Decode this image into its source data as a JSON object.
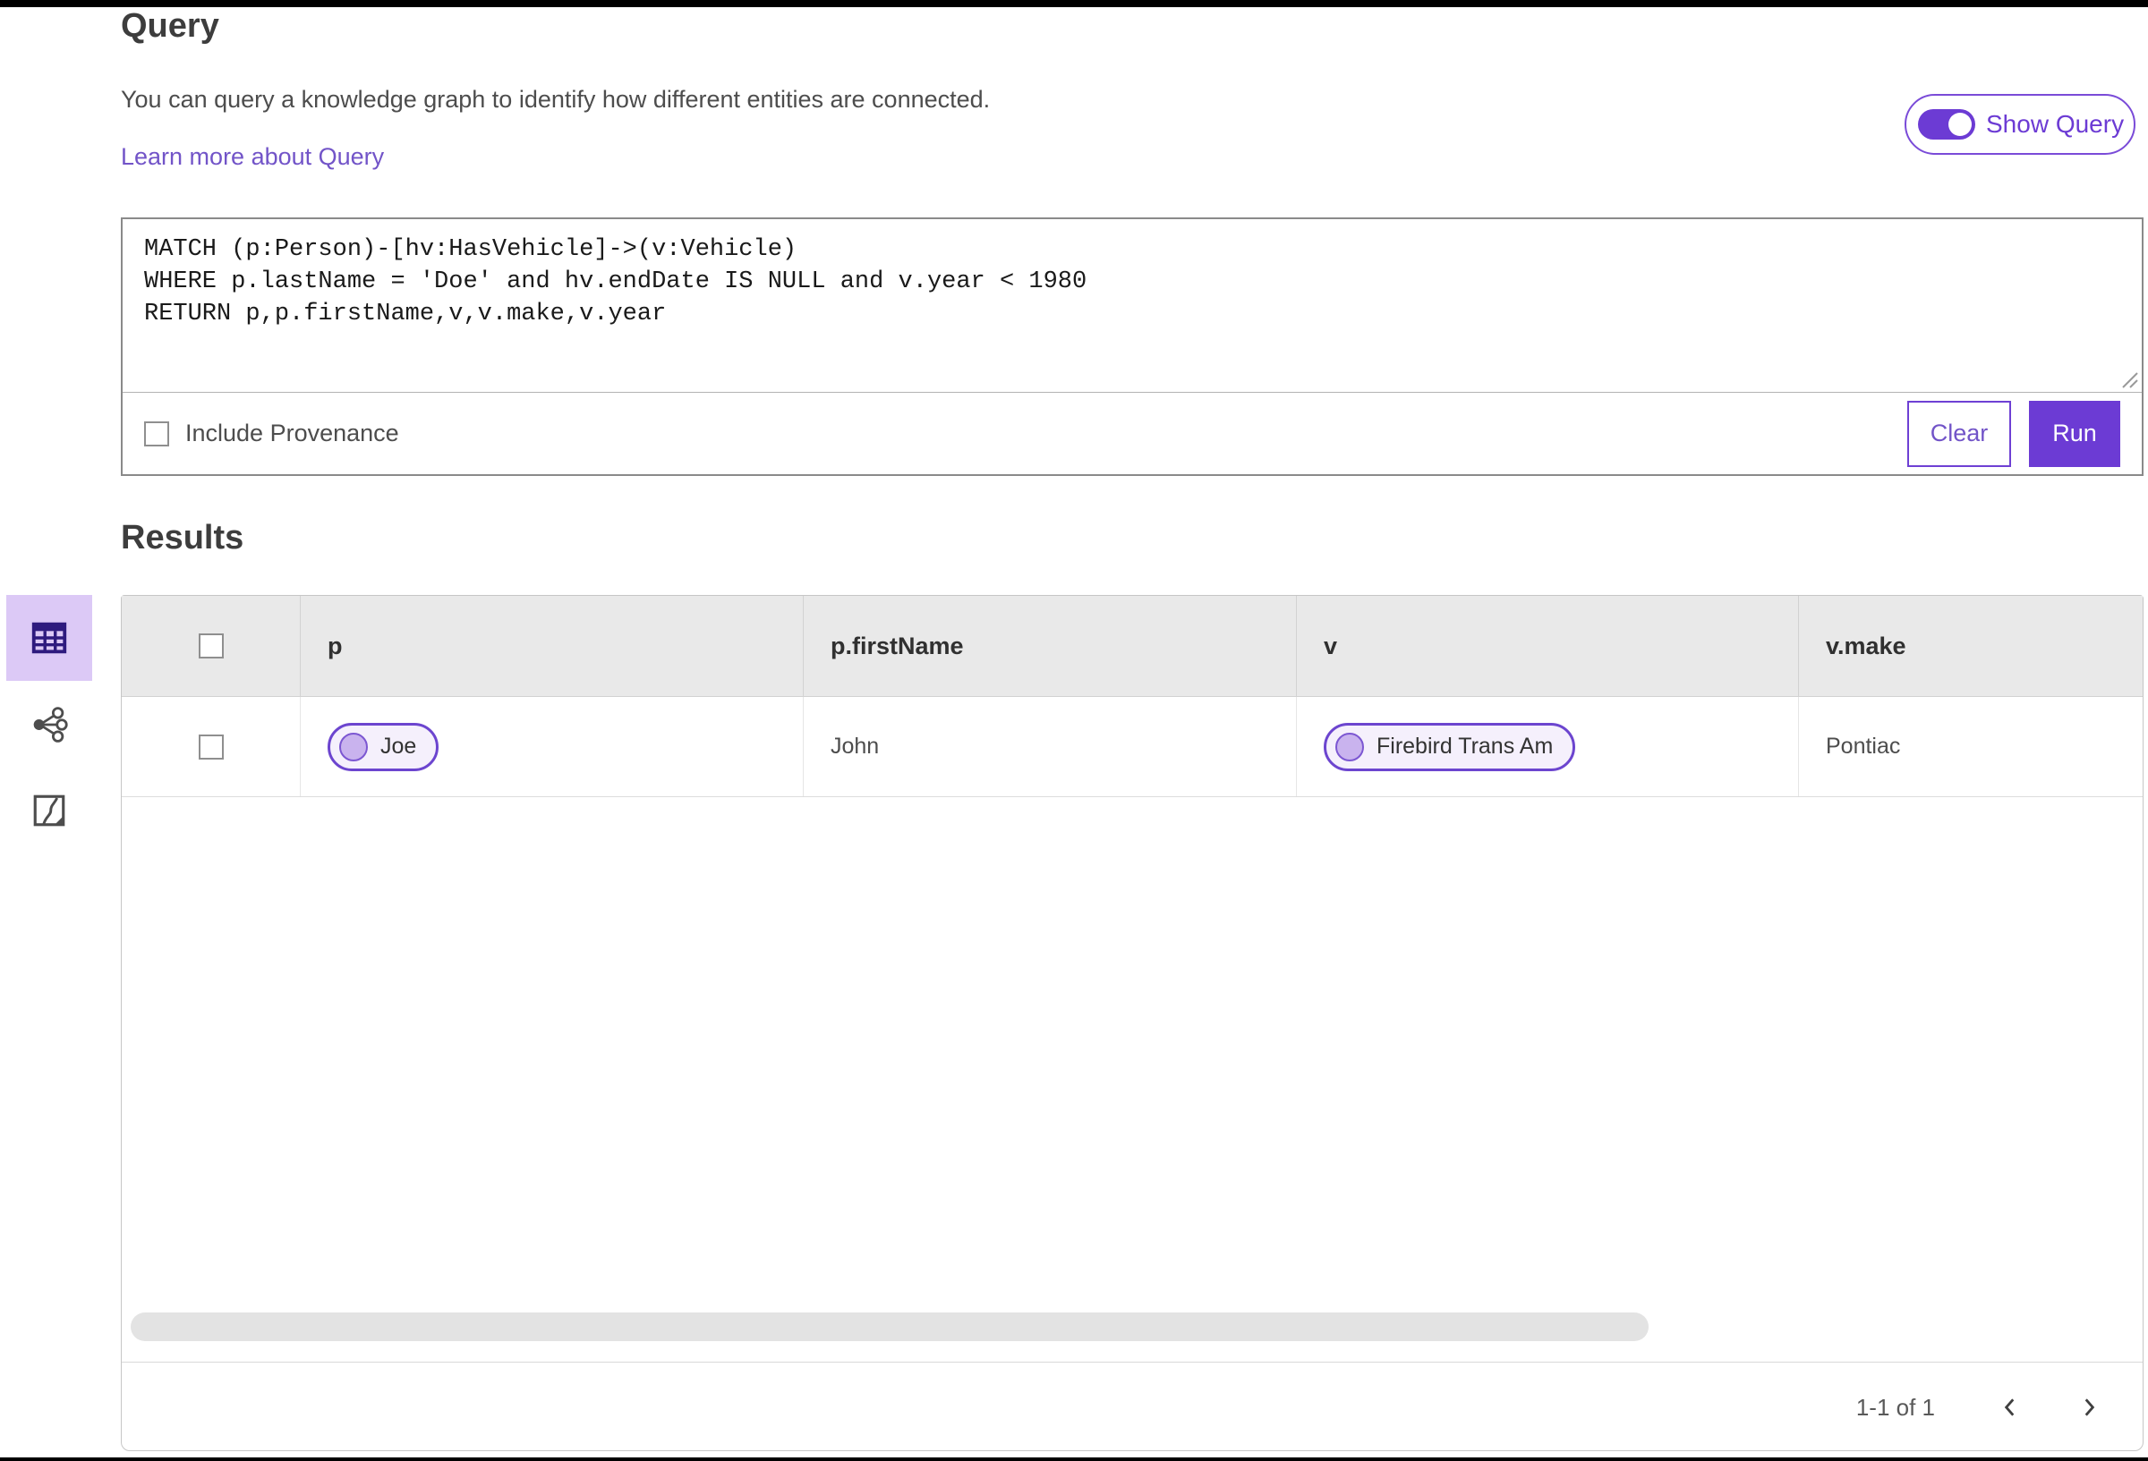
{
  "page": {
    "title": "Query",
    "description": "You can query a knowledge graph to identify how different entities are connected.",
    "learn_more_link": "Learn more about Query",
    "show_query_toggle": {
      "label": "Show Query",
      "state": "on"
    }
  },
  "query_editor": {
    "text": "MATCH (p:Person)-[hv:HasVehicle]->(v:Vehicle)\nWHERE p.lastName = 'Doe' and hv.endDate IS NULL and v.year < 1980\nRETURN p,p.firstName,v,v.make,v.year",
    "include_provenance": {
      "label": "Include Provenance",
      "checked": false
    },
    "clear_button": "Clear",
    "run_button": "Run"
  },
  "results": {
    "title": "Results",
    "view_rail": [
      {
        "name": "table-view",
        "selected": true
      },
      {
        "name": "link-analysis-view",
        "selected": false
      },
      {
        "name": "map-view",
        "selected": false
      }
    ],
    "table": {
      "columns": [
        "p",
        "p.firstName",
        "v",
        "v.make"
      ],
      "rows": [
        {
          "p": "Joe",
          "firstName": "John",
          "v": "Firebird Trans Am",
          "make": "Pontiac",
          "selected": false
        }
      ]
    },
    "pagination": {
      "range_label": "1-1 of 1"
    }
  },
  "colors": {
    "accent_purple": "#6c3bd4",
    "link_purple": "#7254c8",
    "chip_border": "#6c45cf",
    "chip_background": "#f5f0fc",
    "chip_avatar": "#c9b3ee",
    "selected_rail_background": "#dcc9f6",
    "rail_icon_purple": "#2e1a7e",
    "table_header_background": "#e9e9e9",
    "panel_border": "#c6c6c6",
    "query_box_border": "#8a8a8a"
  }
}
